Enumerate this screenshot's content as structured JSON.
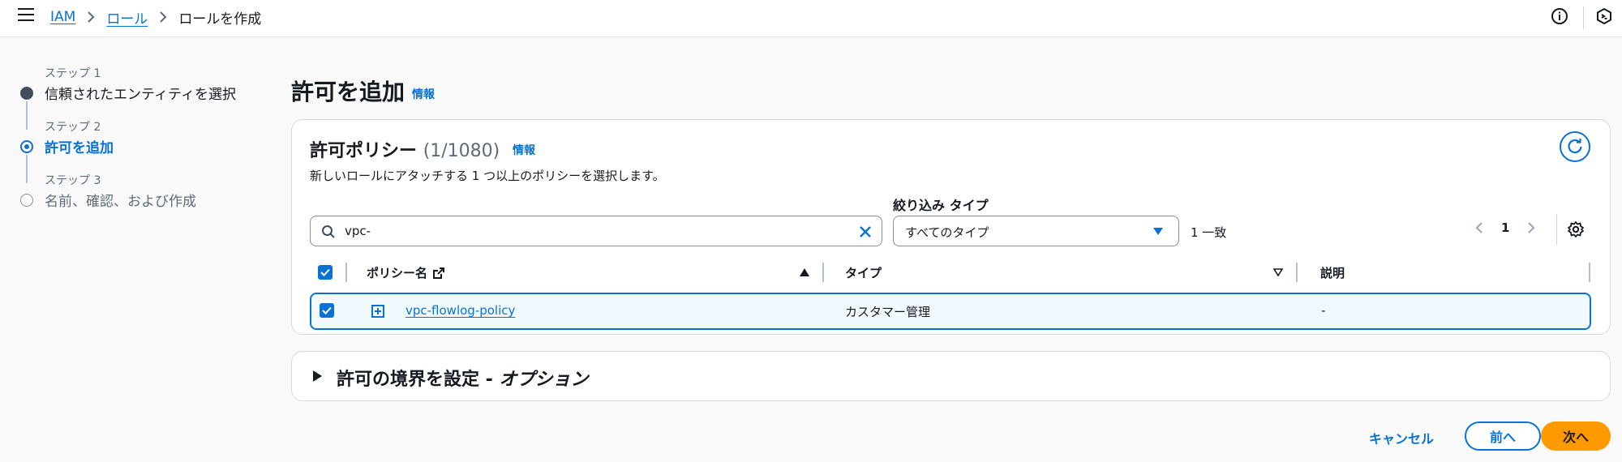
{
  "breadcrumbs": {
    "items": [
      {
        "label": "IAM"
      },
      {
        "label": "ロール"
      },
      {
        "label": "ロールを作成"
      }
    ]
  },
  "steps": [
    {
      "label": "ステップ 1",
      "title": "信頼されたエンティティを選択",
      "state": "done"
    },
    {
      "label": "ステップ 2",
      "title": "許可を追加",
      "state": "current"
    },
    {
      "label": "ステップ 3",
      "title": "名前、確認、および作成",
      "state": "pending"
    }
  ],
  "page": {
    "title": "許可を追加",
    "info_label": "情報"
  },
  "policies": {
    "title": "許可ポリシー",
    "count": "(1/1080)",
    "info_label": "情報",
    "description": "新しいロールにアタッチする 1 つ以上のポリシーを選択します。",
    "filter_label": "絞り込み タイプ",
    "search_value": "vpc-",
    "type_selected": "すべてのタイプ",
    "match_count": "1 一致",
    "current_page": "1",
    "columns": {
      "name": "ポリシー名",
      "type": "タイプ",
      "description": "説明"
    },
    "rows": [
      {
        "name": "vpc-flowlog-policy",
        "type": "カスタマー管理",
        "description": "-"
      }
    ]
  },
  "boundary": {
    "title": "許可の境界を設定 - ",
    "optional": "オプション"
  },
  "footer": {
    "cancel": "キャンセル",
    "previous": "前へ",
    "next": "次へ"
  },
  "colors": {
    "accent": "#0972d3",
    "primary_button": "#ff9900"
  }
}
